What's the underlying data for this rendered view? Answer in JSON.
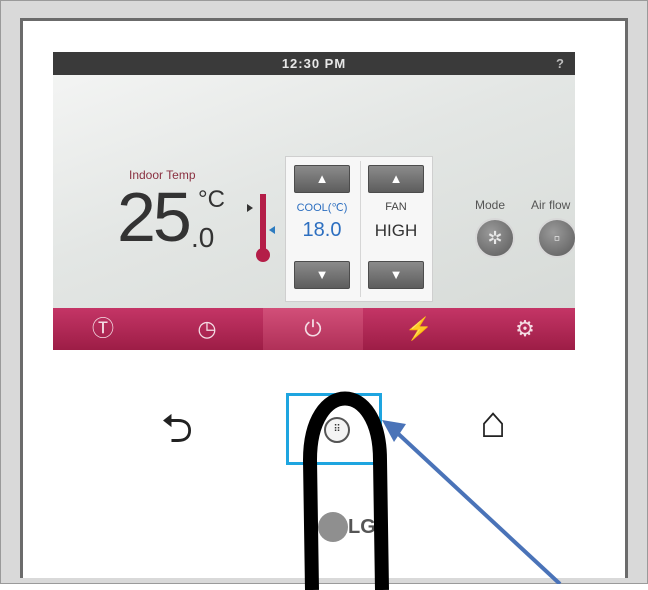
{
  "status_bar": {
    "time": "12:30 PM",
    "help": "?"
  },
  "indoor": {
    "label": "Indoor Temp",
    "integer": "25",
    "decimal": ".0",
    "unit": "°C"
  },
  "controls": {
    "cool": {
      "label": "COOL(℃)",
      "value": "18.0",
      "up": "▲",
      "down": "▼"
    },
    "fan": {
      "label": "FAN",
      "value": "HIGH",
      "up": "▲",
      "down": "▼"
    }
  },
  "mode": {
    "label": "Mode",
    "icon": "✲"
  },
  "airflow": {
    "label": "Air flow",
    "icon": "▫"
  },
  "bottom_bar": {
    "items": [
      {
        "name": "temp-lock",
        "glyph": "Ⓣ"
      },
      {
        "name": "timer",
        "glyph": "◷"
      },
      {
        "name": "power",
        "glyph": "⏻"
      },
      {
        "name": "energy",
        "glyph": "⚡"
      },
      {
        "name": "settings",
        "glyph": "⚙"
      }
    ]
  },
  "hardware": {
    "back": "⮌",
    "center": "⠿",
    "home": "⌂",
    "logo": "LG"
  },
  "colors": {
    "accent": "#b41e48",
    "highlight": "#1ea5e0",
    "arrow": "#4a73b8"
  }
}
